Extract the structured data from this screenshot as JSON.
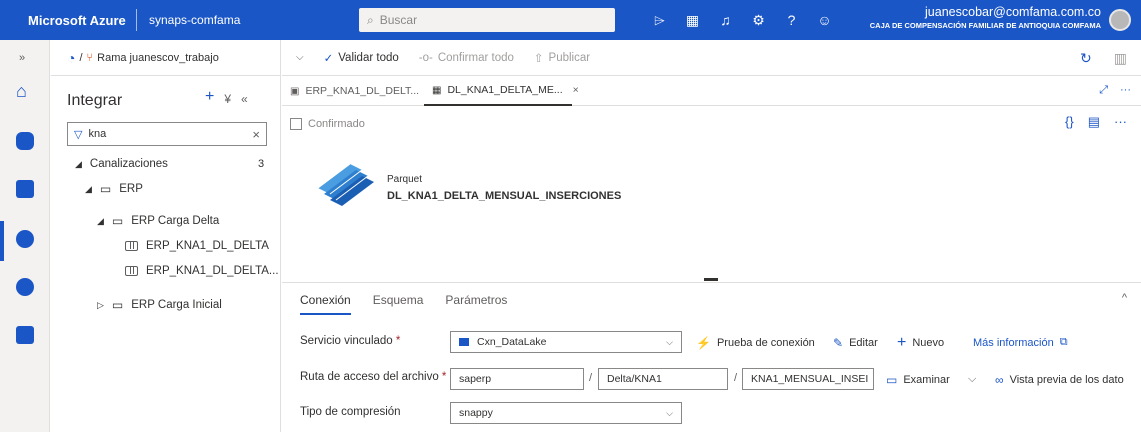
{
  "topbar": {
    "brand": "Microsoft Azure",
    "workspace": "synaps-comfama",
    "search_placeholder": "Buscar",
    "user_email": "juanescobar@comfama.com.co",
    "user_org": "CAJA DE COMPENSACIÓN FAMILIAR DE ANTIOQUIA COMFAMA"
  },
  "branch": {
    "label": "Rama juanescov_trabajo"
  },
  "toolbar": {
    "validate_all": "Validar todo",
    "confirm_all": "Confirmar todo",
    "publish": "Publicar"
  },
  "explorer": {
    "title": "Integrar",
    "filter_value": "kna",
    "tree": {
      "pipelines": {
        "label": "Canalizaciones",
        "count": "3"
      },
      "erp": "ERP",
      "erp_delta": "ERP Carga Delta",
      "item1": "ERP_KNA1_DL_DELTA",
      "item2": "ERP_KNA1_DL_DELTA...",
      "erp_initial": "ERP Carga Inicial"
    }
  },
  "tabs": [
    {
      "label": "ERP_KNA1_DL_DELT..."
    },
    {
      "label": "DL_KNA1_DELTA_ME..."
    }
  ],
  "status": {
    "text": "Confirmado"
  },
  "dataset": {
    "type": "Parquet",
    "name": "DL_KNA1_DELTA_MENSUAL_INSERCIONES"
  },
  "panel": {
    "tabs": [
      "Conexión",
      "Esquema",
      "Parámetros"
    ],
    "linked_service": {
      "label": "Servicio vinculado",
      "value": "Cxn_DataLake",
      "test_connection": "Prueba de conexión",
      "edit": "Editar",
      "new": "Nuevo",
      "more_info": "Más información"
    },
    "file_path": {
      "label": "Ruta de acceso del archivo",
      "container": "saperp",
      "directory": "Delta/KNA1",
      "file": "KNA1_MENSUAL_INSEI",
      "browse": "Examinar",
      "preview": "Vista previa de los dato"
    },
    "compression": {
      "label": "Tipo de compresión",
      "value": "snappy"
    }
  },
  "colors": {
    "accent": "#1b56c6",
    "required": "#a4262c"
  }
}
